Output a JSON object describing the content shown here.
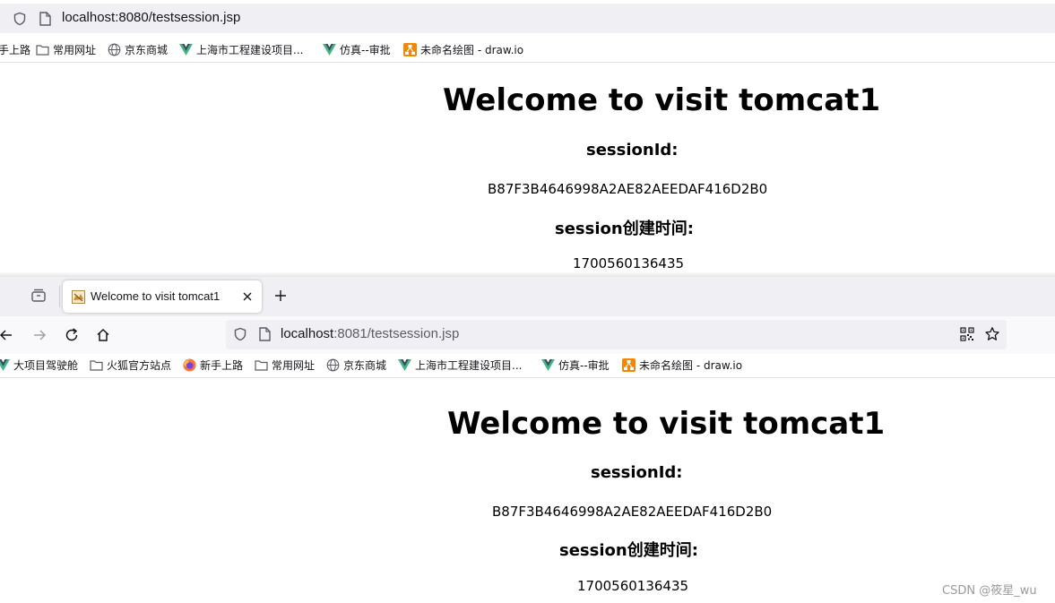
{
  "window1": {
    "url": "localhost:8080/testsession.jsp",
    "bookmarks": [
      "手上路",
      "常用网址",
      "京东商城",
      "上海市工程建设项目...",
      "仿真--审批",
      "未命名绘图 - draw.io"
    ],
    "page": {
      "heading": "Welcome to visit tomcat1",
      "session_id_label": "sessionId:",
      "session_id": "B87F3B4646998A2AE82AEEDAF416D2B0",
      "created_label": "session创建时间:",
      "created_time": "1700560136435"
    }
  },
  "window2": {
    "tab_title": "Welcome to visit tomcat1",
    "url_host": "localhost",
    "url_rest": ":8081/testsession.jsp",
    "bookmarks": [
      "大项目驾驶舱",
      "火狐官方站点",
      "新手上路",
      "常用网址",
      "京东商城",
      "上海市工程建设项目...",
      "仿真--审批",
      "未命名绘图 - draw.io"
    ],
    "page": {
      "heading": "Welcome to visit tomcat1",
      "session_id_label": "sessionId:",
      "session_id": "B87F3B4646998A2AE82AEEDAF416D2B0",
      "created_label": "session创建时间:",
      "created_time": "1700560136435"
    }
  },
  "watermark": "CSDN @筱星_wu",
  "colors": {
    "urlbar_bg": "#f0f0f4",
    "vue_green": "#41b883",
    "drawio_orange": "#f08705",
    "firefox_orange": "#ff7139"
  }
}
